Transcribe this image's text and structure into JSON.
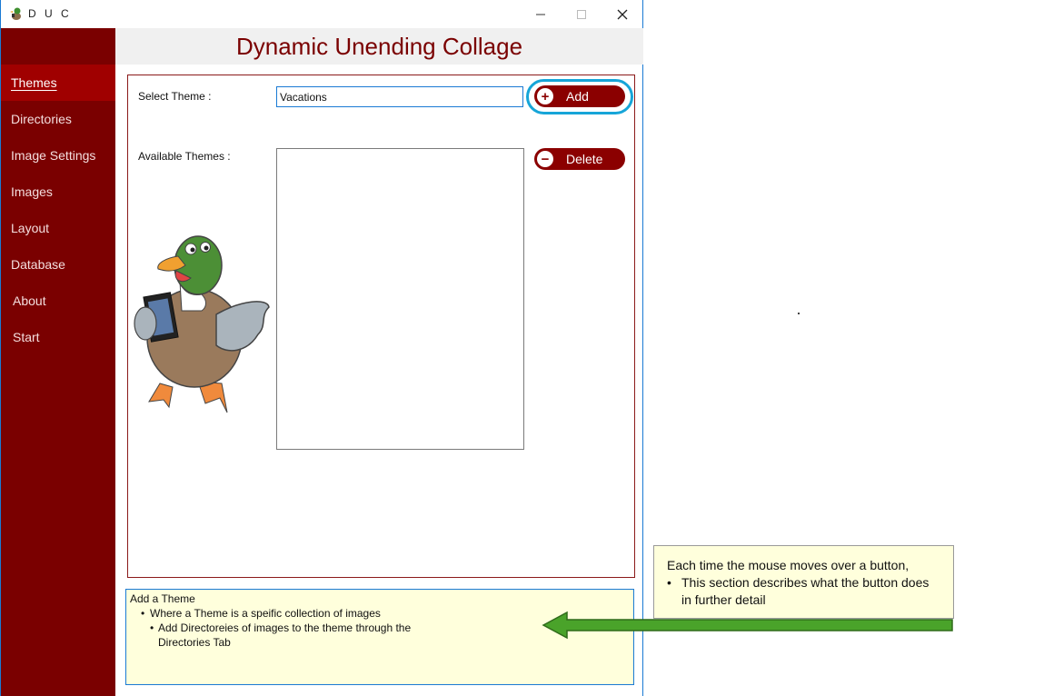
{
  "window": {
    "title": "D U C"
  },
  "header": {
    "title": "Dynamic Unending Collage"
  },
  "sidebar": {
    "items": [
      {
        "label": "Themes",
        "active": true
      },
      {
        "label": "Directories"
      },
      {
        "label": "Image Settings"
      },
      {
        "label": "Images"
      },
      {
        "label": "Layout"
      },
      {
        "label": "Database"
      },
      {
        "label": "About"
      },
      {
        "label": "Start"
      }
    ]
  },
  "themes": {
    "select_label": "Select Theme :",
    "select_value": "Vacations",
    "add_label": "Add",
    "available_label": "Available Themes :",
    "delete_label": "Delete",
    "available_items": []
  },
  "description": {
    "title": "Add a Theme",
    "bullet1": "Where a Theme is a speific collection of images",
    "bullet2_line1": "Add Directoreies of images to the theme through the",
    "bullet2_line2": "Directories Tab"
  },
  "callout": {
    "line1": "Each time the mouse moves over a button,",
    "bullet_line1": "This section describes what the button does",
    "bullet_line2": "in further detail"
  },
  "colors": {
    "sidebar": "#7a0000",
    "sidebar_active": "#a00000",
    "accent": "#8b0000",
    "highlight": "#16a5d8",
    "arrow": "#4aa32a",
    "note_bg": "#ffffdc"
  },
  "icons": {
    "app": "duck-icon",
    "add": "plus-circle-icon",
    "delete": "minus-circle-icon",
    "mascot": "duck-mascot-image"
  }
}
